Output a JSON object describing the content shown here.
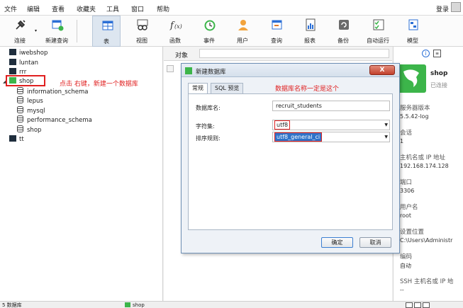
{
  "menu": [
    "文件",
    "编辑",
    "查看",
    "收藏夹",
    "工具",
    "窗口",
    "帮助"
  ],
  "login_label": "登录",
  "toolbar": [
    {
      "label": "连接",
      "icon": "plug-icon"
    },
    {
      "label": "新建查询",
      "icon": "new-query-icon"
    },
    {
      "label": "表",
      "icon": "table-icon"
    },
    {
      "label": "视图",
      "icon": "view-icon"
    },
    {
      "label": "函数",
      "icon": "function-icon"
    },
    {
      "label": "事件",
      "icon": "event-clock-icon"
    },
    {
      "label": "用户",
      "icon": "user-icon"
    },
    {
      "label": "查询",
      "icon": "query-icon"
    },
    {
      "label": "报表",
      "icon": "report-icon"
    },
    {
      "label": "备份",
      "icon": "backup-icon"
    },
    {
      "label": "自动运行",
      "icon": "automation-icon"
    },
    {
      "label": "模型",
      "icon": "model-icon"
    }
  ],
  "tree": {
    "connections": [
      "iwebshop",
      "luntan",
      "rrr",
      "shop",
      "tt"
    ],
    "shop_databases": [
      "information_schema",
      "lepus",
      "mysql",
      "performance_schema",
      "shop"
    ],
    "annotation": "点击 右键，新建一个数据库"
  },
  "object_tab": {
    "label": "对象"
  },
  "dialog": {
    "title": "新建数据库",
    "close_label": "X",
    "tabs": [
      "常规",
      "SQL 预览"
    ],
    "annotation": "数据库名称一定是这个",
    "fields": {
      "db_name_label": "数据库名:",
      "db_name_value": "recruit_students",
      "charset_label": "字符集:",
      "charset_value": "utf8",
      "collation_label": "排序规则:",
      "collation_value": "utf8_general_ci"
    },
    "ok_label": "确定",
    "cancel_label": "取消"
  },
  "right_panel": {
    "name": "shop",
    "status": "已连接",
    "info_icon": "i",
    "ddl_icon": "≡",
    "rows": [
      {
        "key": "服务器版本",
        "value": "5.5.42-log"
      },
      {
        "key": "会话",
        "value": "1"
      },
      {
        "key": "主机名或 IP 地址",
        "value": "192.168.174.128"
      },
      {
        "key": "端口",
        "value": "3306"
      },
      {
        "key": "用户名",
        "value": "root"
      },
      {
        "key": "设置位置",
        "value": "C:\\Users\\Administr"
      },
      {
        "key": "编码",
        "value": "自动"
      },
      {
        "key": "SSH 主机名或 IP 地",
        "value": "--"
      }
    ]
  },
  "status": {
    "left": "5 数据库",
    "connection": "shop"
  },
  "colors": {
    "accent_green": "#3cb54a",
    "annotation_red": "#e02020",
    "selection_blue": "#2f73c9"
  }
}
